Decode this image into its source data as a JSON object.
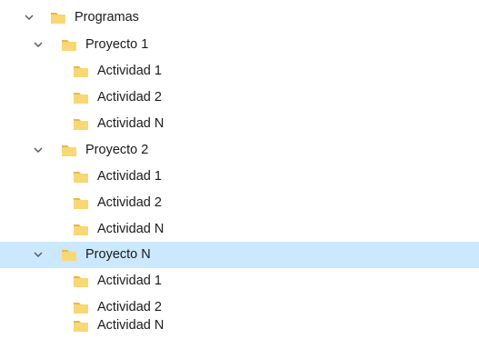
{
  "tree": {
    "root": {
      "label": "Programas",
      "chevron_icon": "chevron-down-icon",
      "folder_icon": "folder-icon"
    },
    "projects": [
      {
        "label": "Proyecto 1",
        "expanded": true,
        "selected": false,
        "activities": [
          "Actividad 1",
          "Actividad 2",
          "Actividad N"
        ]
      },
      {
        "label": "Proyecto 2",
        "expanded": true,
        "selected": false,
        "activities": [
          "Actividad 1",
          "Actividad 2",
          "Actividad N"
        ]
      },
      {
        "label": "Proyecto N",
        "expanded": true,
        "selected": true,
        "activities": [
          "Actividad 1",
          "Actividad 2",
          "Actividad N"
        ]
      }
    ]
  },
  "colors": {
    "selection": "#cce8ff",
    "folder_body": "#f8d775",
    "folder_tab": "#e6b845",
    "chevron": "#555555"
  }
}
